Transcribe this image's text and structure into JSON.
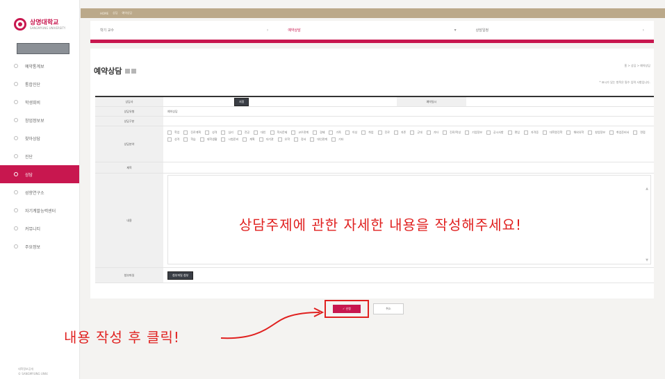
{
  "sidebar": {
    "logo_name": "상명대학교",
    "logo_sub": "SANGMYUNG UNIVERSITY",
    "items": [
      {
        "label": "예약통계보"
      },
      {
        "label": "통합진단"
      },
      {
        "label": "학생회비"
      },
      {
        "label": "창업정보보"
      },
      {
        "label": "찾아상담"
      },
      {
        "label": "진단"
      },
      {
        "label": "상담"
      },
      {
        "label": "성향연구소"
      },
      {
        "label": "자기계발능력센터"
      },
      {
        "label": "커뮤니티"
      },
      {
        "label": "주요정보"
      }
    ],
    "footer_line1": "대학정보공개",
    "footer_line2": "© SANGMYUNG UNIV."
  },
  "topbar": {
    "items": [
      "HOME",
      "상담",
      "예약상담"
    ]
  },
  "breadcrumb": {
    "items": [
      {
        "label": "학기 교수"
      },
      {
        "label": "예약상담"
      },
      {
        "label": "상담일정"
      }
    ]
  },
  "page": {
    "title": "예약상담",
    "path": "홈 > 상담 > 예약상담",
    "note": "* 표시가 있는 항목은 필수 입력 사항입니다."
  },
  "form": {
    "row1": {
      "label": "상담사",
      "button": "지정",
      "label2": "예약일시"
    },
    "row2": {
      "label": "상담유형",
      "value": "예약상담"
    },
    "row3": {
      "label": "상담구분"
    },
    "row4": {
      "label": "상담분야",
      "categories": [
        "학업",
        "진로계획",
        "성격",
        "심리",
        "전공",
        "대인",
        "학사문제",
        "교우관계",
        "경제",
        "가족",
        "이성",
        "취업",
        "진로",
        "자존",
        "군대",
        "기타",
        "진로/적성",
        "기업정보",
        "공시사항",
        "편입",
        "자격증",
        "대학원진학",
        "해외유학",
        "창업정보",
        "취업준비서",
        "면접",
        "성격",
        "학습",
        "대학생활",
        "시험준비",
        "계획",
        "자기관",
        "유학",
        "정서",
        "대인관계",
        "기타"
      ]
    },
    "row5": {
      "label": "제목"
    },
    "row6": {
      "label": "내용"
    },
    "row7": {
      "label": "첨부파일",
      "button": "첨부파일 첨부"
    }
  },
  "overlay": "상담주제에 관한 자세한 내용을 작성해주세요!",
  "actions": {
    "save": "✓ 신청",
    "cancel": "취소"
  },
  "annotation": "내용 작성 후 클릭!",
  "colors": {
    "accent": "#c8174f",
    "annotation": "#e0201f",
    "topbar": "#bba98a"
  }
}
